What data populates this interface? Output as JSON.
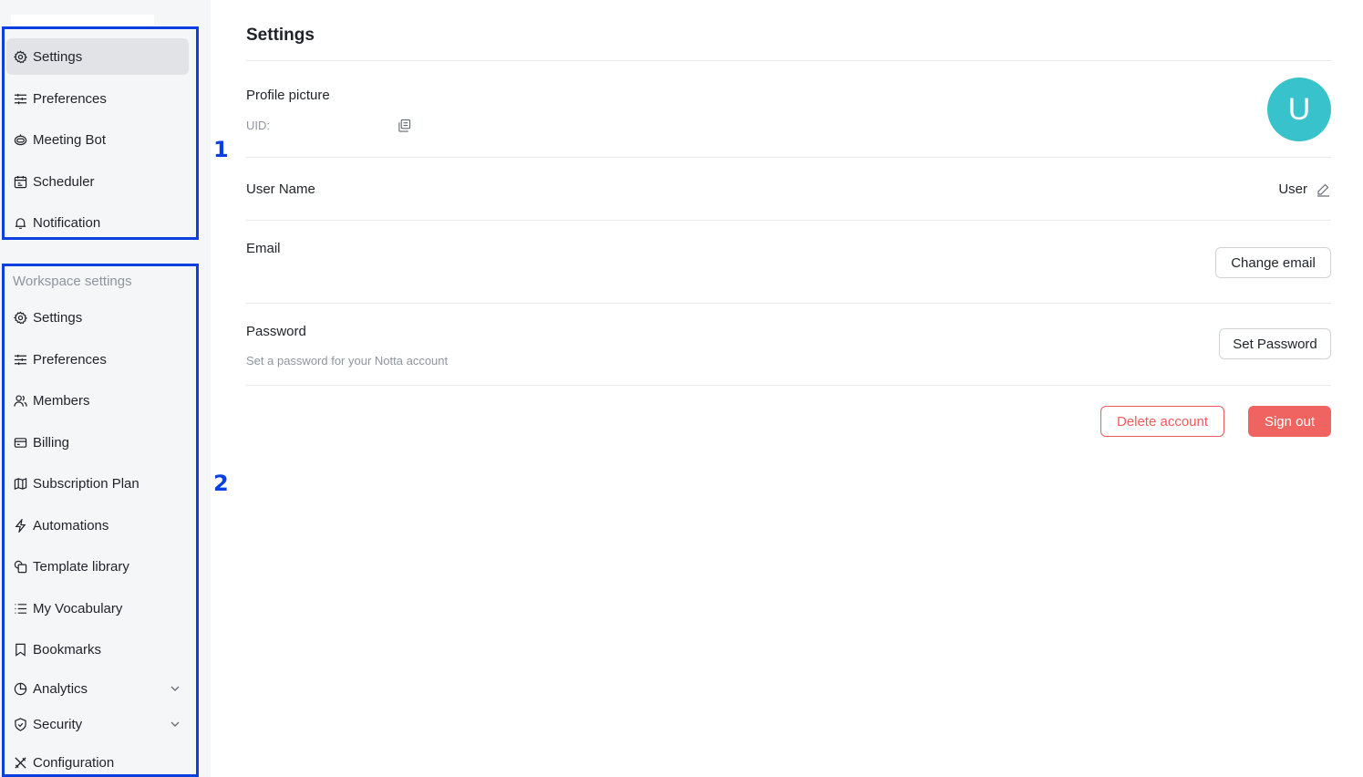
{
  "sidebar": {
    "personal_items": [
      {
        "label": "Settings",
        "icon": "gear-icon",
        "active": true
      },
      {
        "label": "Preferences",
        "icon": "sliders-icon"
      },
      {
        "label": "Meeting Bot",
        "icon": "bot-icon"
      },
      {
        "label": "Scheduler",
        "icon": "calendar-icon"
      },
      {
        "label": "Notification",
        "icon": "bell-icon"
      }
    ],
    "workspace_label": "Workspace settings",
    "workspace_items": [
      {
        "label": "Settings",
        "icon": "gear-icon"
      },
      {
        "label": "Preferences",
        "icon": "sliders-icon"
      },
      {
        "label": "Members",
        "icon": "users-icon"
      },
      {
        "label": "Billing",
        "icon": "card-icon"
      },
      {
        "label": "Subscription Plan",
        "icon": "map-icon"
      },
      {
        "label": "Automations",
        "icon": "bolt-icon"
      },
      {
        "label": "Template library",
        "icon": "template-icon"
      },
      {
        "label": "My Vocabulary",
        "icon": "list-icon"
      },
      {
        "label": "Bookmarks",
        "icon": "bookmark-icon"
      },
      {
        "label": "Analytics",
        "icon": "pie-chart-icon"
      },
      {
        "label": "Security",
        "icon": "shield-icon"
      },
      {
        "label": "Configuration",
        "icon": "tools-icon"
      }
    ]
  },
  "annotations": {
    "box1": "1",
    "box2": "2"
  },
  "main": {
    "title": "Settings",
    "profile_picture_label": "Profile picture",
    "uid_label": "UID:",
    "avatar_letter": "U",
    "user_name_label": "User Name",
    "user_name_value": "User",
    "email_label": "Email",
    "change_email_button": "Change email",
    "password_label": "Password",
    "password_hint": "Set a password for your Notta account",
    "set_password_button": "Set Password",
    "delete_account_button": "Delete account",
    "sign_out_button": "Sign out"
  },
  "colors": {
    "accent_avatar": "#38c3cc",
    "danger": "#ef6461",
    "annotation": "#0a3fe0"
  }
}
